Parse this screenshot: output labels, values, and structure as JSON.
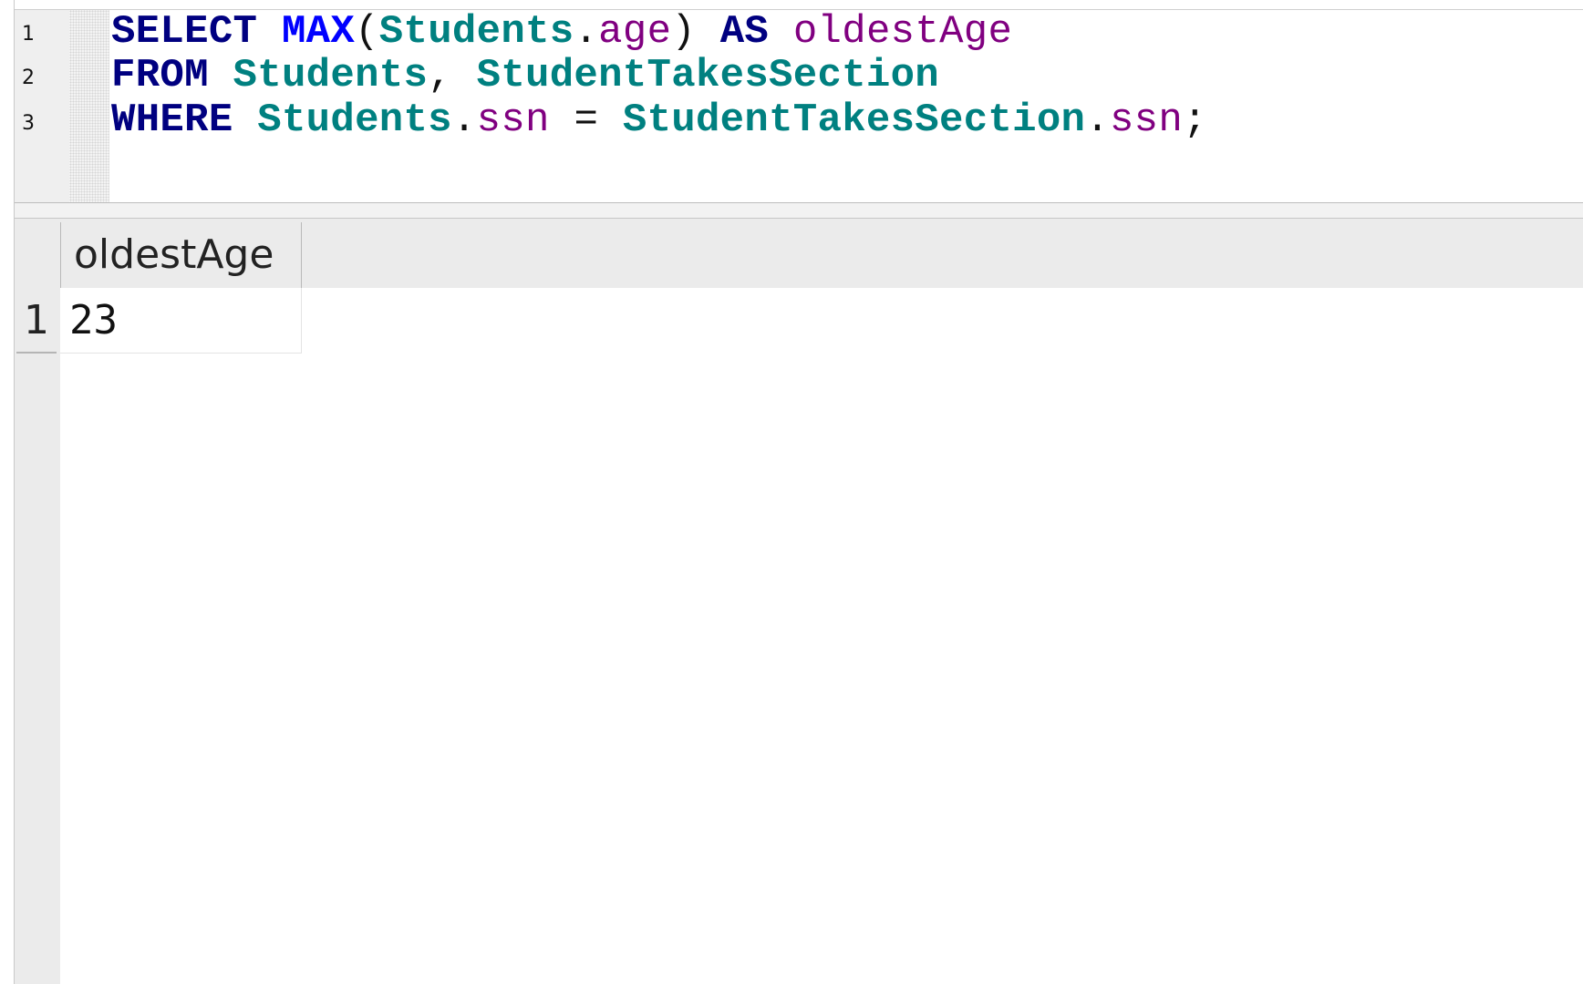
{
  "editor": {
    "line_numbers": [
      "1",
      "2",
      "3"
    ],
    "lines": [
      [
        {
          "text": "SELECT",
          "cls": "kw"
        },
        {
          "text": " ",
          "cls": "pn"
        },
        {
          "text": "MAX",
          "cls": "fn"
        },
        {
          "text": "(",
          "cls": "pn"
        },
        {
          "text": "Students",
          "cls": "tbl"
        },
        {
          "text": ".",
          "cls": "pn"
        },
        {
          "text": "age",
          "cls": "col"
        },
        {
          "text": ") ",
          "cls": "pn"
        },
        {
          "text": "AS",
          "cls": "kw"
        },
        {
          "text": " ",
          "cls": "pn"
        },
        {
          "text": "oldestAge",
          "cls": "col"
        }
      ],
      [
        {
          "text": "FROM",
          "cls": "kw"
        },
        {
          "text": " ",
          "cls": "pn"
        },
        {
          "text": "Students",
          "cls": "tbl"
        },
        {
          "text": ", ",
          "cls": "pn"
        },
        {
          "text": "StudentTakesSection",
          "cls": "tbl"
        }
      ],
      [
        {
          "text": "WHERE",
          "cls": "kw"
        },
        {
          "text": " ",
          "cls": "pn"
        },
        {
          "text": "Students",
          "cls": "tbl"
        },
        {
          "text": ".",
          "cls": "pn"
        },
        {
          "text": "ssn",
          "cls": "col"
        },
        {
          "text": " = ",
          "cls": "pn"
        },
        {
          "text": "StudentTakesSection",
          "cls": "tbl"
        },
        {
          "text": ".",
          "cls": "pn"
        },
        {
          "text": "ssn",
          "cls": "col"
        },
        {
          "text": ";",
          "cls": "pn"
        }
      ]
    ]
  },
  "results": {
    "columns": [
      "oldestAge"
    ],
    "rows": [
      {
        "row_number": "1",
        "cells": [
          "23"
        ]
      }
    ]
  },
  "colors": {
    "keyword": "#000080",
    "function": "#0000ff",
    "table": "#008080",
    "column": "#800080"
  }
}
